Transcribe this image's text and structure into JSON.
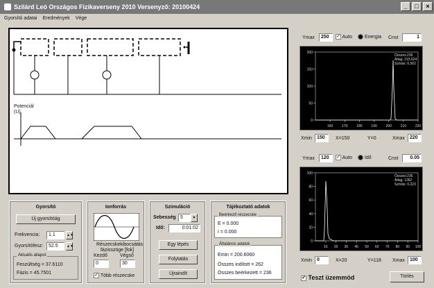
{
  "window": {
    "title": "Szilárd Leó Országos Fizikaverseny 2010  Versenyző: 20100424"
  },
  "menu": [
    "Gyorsító adatai",
    "Eredmények",
    "Vége"
  ],
  "potential_label": "Potenciál\n(U)",
  "gyorsito": {
    "title": "Gyorsító",
    "new_button": "Új gyorsítóág",
    "freq_label": "Frekvencia:",
    "freq_value": "1.1",
    "gyorsitoesz_label": "Gyorsítófesz:",
    "gyorsitoesz_value": "52.5",
    "actual_legend": "Aktuális állapot",
    "feszultseg": "Feszültség =  37.6110",
    "fazis": "Fázis =  45.7501"
  },
  "ionforras": {
    "title": "Ionforrás",
    "desc1": "Részecskekibocsátás",
    "desc2": "fázisszöge [fok]",
    "start_label": "Kezdő",
    "end_label": "Végső",
    "start_value": "0",
    "end_value": "30",
    "multi_label": "Több részecske"
  },
  "szimulacio": {
    "title": "Szimuláció",
    "speed_label": "Sebesség",
    "speed_value": "5",
    "time_label": "Idő:",
    "time_value": "0:01:02",
    "step_button": "Egy lépés",
    "continue_button": "Folytatás",
    "restart_button": "Újraindít"
  },
  "tajekoztato": {
    "title": "Tájékoztató adatok",
    "selected_legend": "Beérkező részecske",
    "e_value": "E = 0.000",
    "i_value": "I = 0.000",
    "general_legend": "Általános adatok",
    "emin": "Emin =  200.6060",
    "inditott": "Összes indított = 262",
    "beerkezett": "Összes beérkezett = 236"
  },
  "top_graph": {
    "ymax_label": "Ymax",
    "ymax_value": "250",
    "auto_label": "Auto",
    "energia_label": "Energia",
    "cnst_label": "Cnst",
    "cnst_value": "1",
    "legend": [
      "Összes:236",
      "Átlag: 215.624",
      "Szórás: 6.562"
    ],
    "xmin_label": "Xmin",
    "xmin_value": "150",
    "x_label": "X=150",
    "y_label": "Y=0",
    "xmax_label": "Xmax",
    "xmax_value": "220",
    "yticks": [
      "200",
      "150",
      "100",
      "50",
      "0"
    ],
    "xticks": [
      "160",
      "170",
      "180",
      "190",
      "200",
      "210",
      "220"
    ]
  },
  "bottom_graph": {
    "ymax_label": "Ymax",
    "ymax_value": "120",
    "auto_label": "Auto",
    "ido_label": "Idő",
    "cnst_label": "Cnst",
    "cnst_value": "0.05",
    "legend": [
      "Összes:236",
      "Átlag: 1362",
      "Szórás: 0.223"
    ],
    "xmin_label": "Xmin",
    "xmin_value": "0",
    "x_label": "X=20",
    "y_label": "Y=118",
    "xmax_label": "Xmax",
    "xmax_value": "100",
    "yticks": [
      "100",
      "80",
      "60",
      "40",
      "20",
      "0"
    ],
    "xticks": [
      "10",
      "20",
      "30",
      "40",
      "50",
      "60",
      "70",
      "80",
      "90",
      "100"
    ]
  },
  "teszt_label": "Teszt üzemmód",
  "torles_button": "Törlés"
}
